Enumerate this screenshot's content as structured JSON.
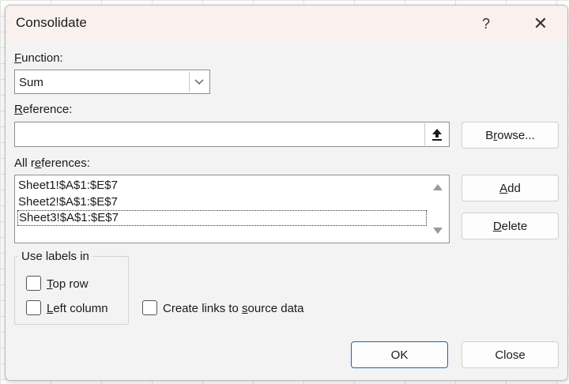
{
  "dialog": {
    "title": "Consolidate",
    "help_label": "?",
    "close_glyph": "✕"
  },
  "function": {
    "label_key": "F",
    "label_rest": "unction:",
    "selected": "Sum"
  },
  "reference": {
    "label_key": "R",
    "label_rest": "eference:",
    "value": ""
  },
  "all_references": {
    "label_pre": "All r",
    "label_key": "e",
    "label_post": "ferences:",
    "items": [
      "Sheet1!$A$1:$E$7",
      "Sheet2!$A$1:$E$7",
      "Sheet3!$A$1:$E$7"
    ]
  },
  "buttons": {
    "browse_pre": "B",
    "browse_key": "r",
    "browse_post": "owse...",
    "add_key": "A",
    "add_post": "dd",
    "delete_key": "D",
    "delete_post": "elete",
    "ok": "OK",
    "close": "Close"
  },
  "use_labels": {
    "title": "Use labels in",
    "top_row_key": "T",
    "top_row_post": "op row",
    "left_column_key": "L",
    "left_column_post": "eft column"
  },
  "links": {
    "pre": "Create links to ",
    "key": "s",
    "post": "ource data"
  }
}
